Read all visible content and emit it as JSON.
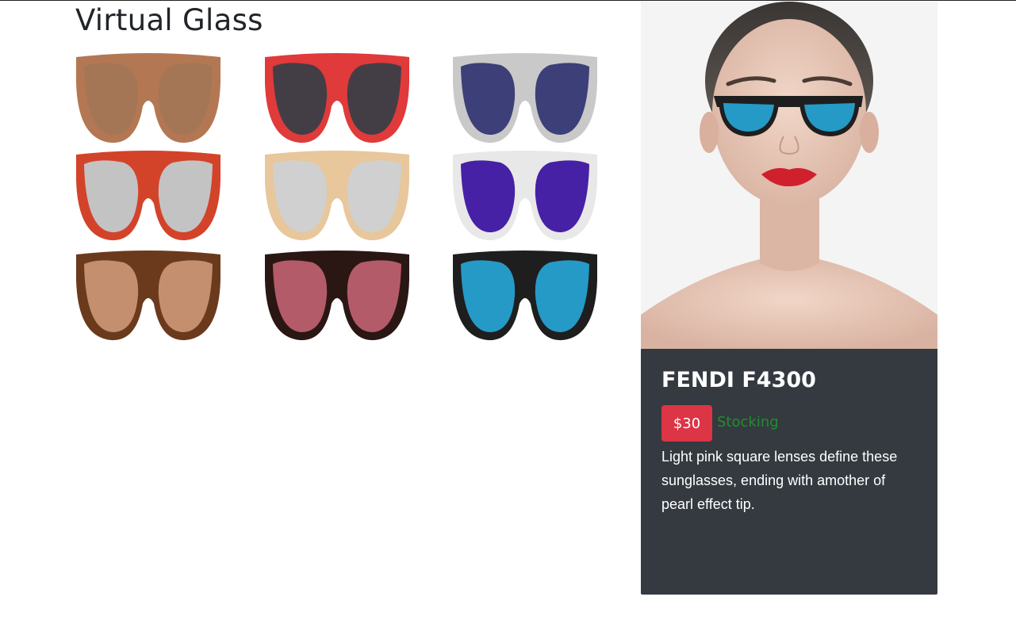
{
  "page": {
    "title": "Virtual Glass"
  },
  "glasses": [
    {
      "frame": "#b37853",
      "lens": "#a57655",
      "icon": "tan-sunglasses-icon"
    },
    {
      "frame": "#e03a3a",
      "lens": "#433e45",
      "icon": "flag-sunglasses-icon"
    },
    {
      "frame": "#c9c9c9",
      "lens": "#3d3f78",
      "icon": "aviator-sunglasses-icon"
    },
    {
      "frame": "#d3432a",
      "lens": "#c3c3c3",
      "icon": "red-sunglasses-icon"
    },
    {
      "frame": "#e7c79b",
      "lens": "#d0d0d0",
      "icon": "beige-cateye-sunglasses-icon"
    },
    {
      "frame": "#e8e8e8",
      "lens": "#4621a6",
      "icon": "white-sunglasses-icon"
    },
    {
      "frame": "#6b3a1c",
      "lens": "#c38f6e",
      "icon": "tortoise-sunglasses-icon"
    },
    {
      "frame": "#2a1714",
      "lens": "#b35b68",
      "icon": "dark-red-sunglasses-icon"
    },
    {
      "frame": "#1e1e1e",
      "lens": "#259ac7",
      "icon": "black-blue-sunglasses-icon"
    }
  ],
  "product": {
    "name": "FENDI F4300",
    "price": "$30",
    "stock_status": "Stocking",
    "description": "Light pink square lenses define these sunglasses, ending with amother of pearl effect tip.",
    "frame_color": "#1e1e1e",
    "lens_color": "#259ac7"
  },
  "colors": {
    "card_bg": "#343a40",
    "price_badge": "#dc3545",
    "stock_text": "#1f8f2c"
  }
}
